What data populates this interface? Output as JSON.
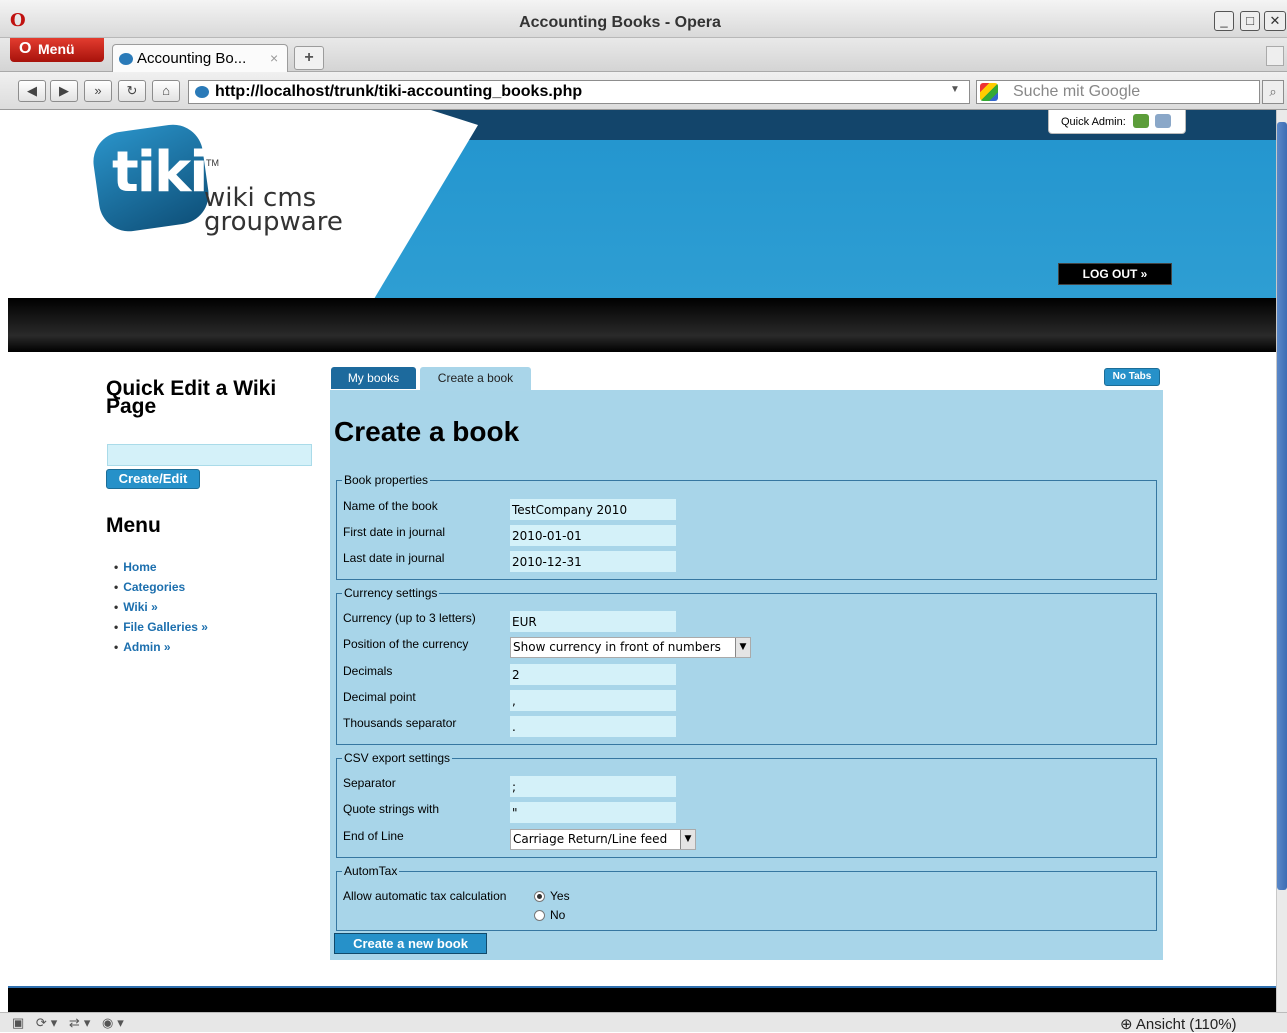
{
  "window": {
    "title": "Accounting Books - Opera"
  },
  "browser": {
    "menu_label": "Menü",
    "tab_label": "Accounting Bo...",
    "tab_close": "×",
    "new_tab": "+",
    "url": "http://localhost/trunk/tiki-accounting_books.php",
    "search_placeholder": "Suche mit Google",
    "zoom_label": "Ansicht (110%)"
  },
  "header": {
    "logo_tiki": "tiki",
    "logo_tm": "TM",
    "logo_lines": "wiki cms groupware",
    "quick_admin_label": "Quick Admin:",
    "logout_label": "LOG OUT »"
  },
  "sidebar": {
    "quick_edit_title": "Quick Edit a Wiki Page",
    "quick_edit_button": "Create/Edit",
    "menu_title": "Menu",
    "menu_items": [
      "Home",
      "Categories",
      "Wiki »",
      "File Galleries »",
      "Admin »"
    ]
  },
  "tabs": {
    "my_books": "My books",
    "create_book": "Create a book",
    "no_tabs": "No Tabs"
  },
  "form": {
    "title": "Create a book",
    "book_properties": {
      "legend": "Book properties",
      "name_label": "Name of the book",
      "name_value": "TestCompany 2010",
      "first_date_label": "First date in journal",
      "first_date_value": "2010-01-01",
      "last_date_label": "Last date in journal",
      "last_date_value": "2010-12-31"
    },
    "currency": {
      "legend": "Currency settings",
      "currency_label": "Currency (up to 3 letters)",
      "currency_value": "EUR",
      "position_label": "Position of the currency",
      "position_value": "Show currency in front of numbers",
      "decimals_label": "Decimals",
      "decimals_value": "2",
      "decimal_point_label": "Decimal point",
      "decimal_point_value": ",",
      "thousands_label": "Thousands separator",
      "thousands_value": "."
    },
    "csv": {
      "legend": "CSV export settings",
      "separator_label": "Separator",
      "separator_value": ";",
      "quote_label": "Quote strings with",
      "quote_value": "\"",
      "eol_label": "End of Line",
      "eol_value": "Carriage Return/Line feed"
    },
    "autom_tax": {
      "legend": "AutomTax",
      "label": "Allow automatic tax calculation",
      "yes": "Yes",
      "no": "No"
    },
    "submit": "Create a new book"
  },
  "colors": {
    "panel_bg": "#a8d5e9",
    "button_blue": "#2691c9",
    "input_bg": "#d4f1f9",
    "banner_blue": "#2496cf"
  }
}
